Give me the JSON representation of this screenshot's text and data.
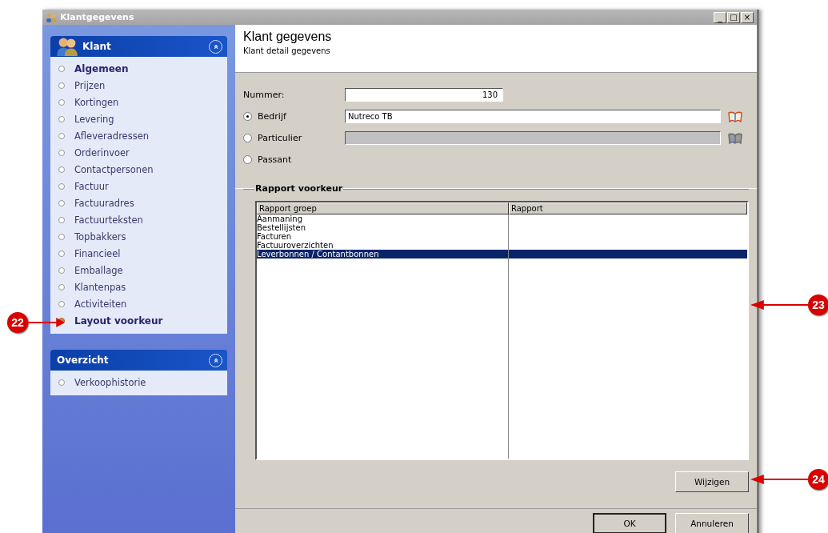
{
  "window": {
    "title": "Klantgegevens",
    "controls": [
      "_",
      "□",
      "×"
    ]
  },
  "sidebar": {
    "sections": [
      {
        "title": "Klant",
        "collapse": "«",
        "items": [
          {
            "label": "Algemeen",
            "bold": true,
            "selected": false
          },
          {
            "label": "Prijzen",
            "bold": false,
            "selected": false
          },
          {
            "label": "Kortingen",
            "bold": false,
            "selected": false
          },
          {
            "label": "Levering",
            "bold": false,
            "selected": false
          },
          {
            "label": "Afleveradressen",
            "bold": false,
            "selected": false
          },
          {
            "label": "Orderinvoer",
            "bold": false,
            "selected": false
          },
          {
            "label": "Contactpersonen",
            "bold": false,
            "selected": false
          },
          {
            "label": "Factuur",
            "bold": false,
            "selected": false
          },
          {
            "label": "Factuuradres",
            "bold": false,
            "selected": false
          },
          {
            "label": "Factuurteksten",
            "bold": false,
            "selected": false
          },
          {
            "label": "Topbakkers",
            "bold": false,
            "selected": false
          },
          {
            "label": "Financieel",
            "bold": false,
            "selected": false
          },
          {
            "label": "Emballage",
            "bold": false,
            "selected": false
          },
          {
            "label": "Klantenpas",
            "bold": false,
            "selected": false
          },
          {
            "label": "Activiteiten",
            "bold": false,
            "selected": false
          },
          {
            "label": "Layout voorkeur",
            "bold": true,
            "selected": true
          }
        ]
      },
      {
        "title": "Overzicht",
        "collapse": "«",
        "items": [
          {
            "label": "Verkoophistorie",
            "bold": false,
            "selected": false
          }
        ]
      }
    ]
  },
  "header": {
    "title": "Klant gegevens",
    "subtitle": "Klant detail gegevens"
  },
  "form": {
    "nummer": {
      "label": "Nummer:",
      "value": "130"
    },
    "options": [
      {
        "label": "Bedrijf",
        "selected": true,
        "value": "Nutreco TB",
        "kind": "input"
      },
      {
        "label": "Particulier",
        "selected": false,
        "kind": "disabled-input"
      },
      {
        "label": "Passant",
        "selected": false,
        "kind": "none"
      }
    ]
  },
  "report_group": {
    "title": "Rapport voorkeur",
    "columns": [
      "Rapport groep",
      "Rapport"
    ],
    "rows": [
      {
        "cells": [
          "Aanmaning",
          ""
        ],
        "selected": false
      },
      {
        "cells": [
          "Bestellijsten",
          ""
        ],
        "selected": false
      },
      {
        "cells": [
          "Facturen",
          ""
        ],
        "selected": false
      },
      {
        "cells": [
          "Factuuroverzichten",
          ""
        ],
        "selected": false
      },
      {
        "cells": [
          "Leverbonnen / Contantbonnen",
          ""
        ],
        "selected": true
      }
    ]
  },
  "buttons": {
    "edit": "Wijzigen",
    "ok": "OK",
    "cancel": "Annuleren"
  },
  "callouts": [
    {
      "number": "22"
    },
    {
      "number": "23"
    },
    {
      "number": "24"
    }
  ]
}
